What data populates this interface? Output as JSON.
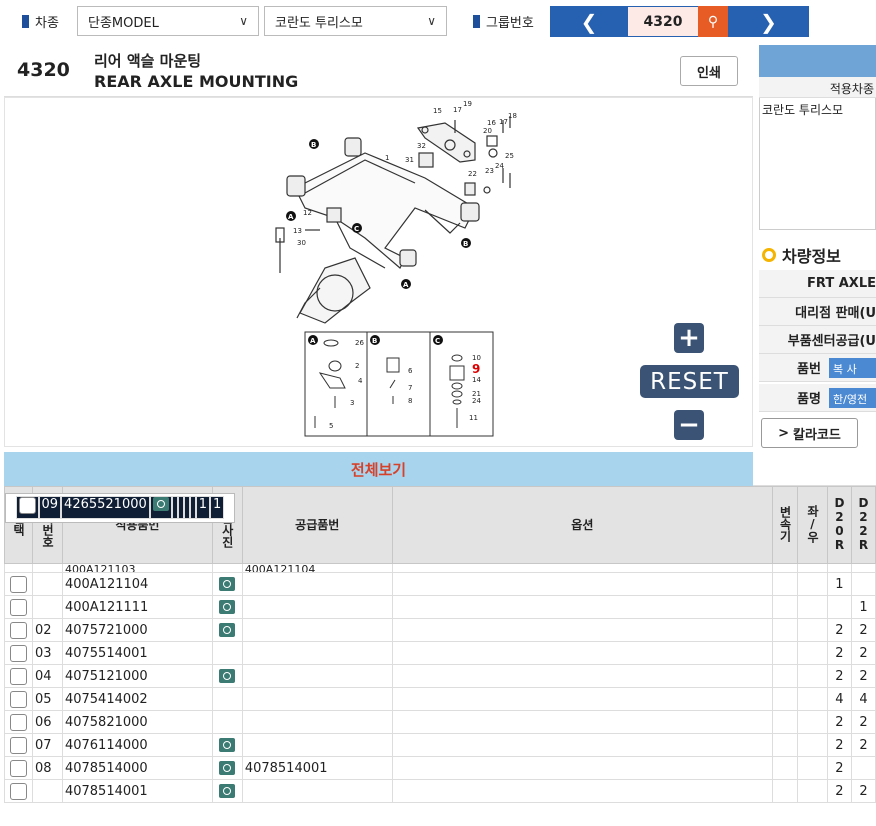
{
  "topbar": {
    "car_label": "차종",
    "model_select": "단종MODEL",
    "vehicle_select": "코란도 투리스모",
    "group_label": "그룹번호",
    "group_number": "4320"
  },
  "header": {
    "group_no": "4320",
    "title_ko": "리어 액슬 마운팅",
    "title_en": "REAR AXLE MOUNTING",
    "print_label": "인쇄"
  },
  "diagram": {
    "reset_label": "RESET",
    "plus": "+",
    "minus": "−",
    "callouts": [
      "1",
      "2",
      "3",
      "4",
      "5",
      "6",
      "7",
      "8",
      "9",
      "10",
      "11",
      "12",
      "13",
      "14",
      "15",
      "16",
      "17",
      "18",
      "19",
      "20",
      "21",
      "22",
      "23",
      "24",
      "25",
      "26",
      "30",
      "31",
      "32"
    ],
    "highlight_callout": "9"
  },
  "right": {
    "applied_col": "적용차종",
    "applied_value": "코란도 투리스모",
    "vehicle_info_title": "차량정보",
    "rows": [
      "FRT AXLE",
      "대리점 판매(U",
      "부품센터공급(U",
      "품번",
      "품명"
    ],
    "btn_copy": "복 사",
    "btn_name": "한/영전",
    "color_code_label": "칼라코드"
  },
  "table": {
    "all_view": "전체보기",
    "headers": [
      "선택",
      "지시번호",
      "적용품번",
      "부품사진",
      "공급품번",
      "옵션",
      "변속기",
      "좌/우",
      "D20R",
      "D22R"
    ],
    "partial_row": {
      "part": "400A121103",
      "supply": "400A121104"
    },
    "rows": [
      {
        "idx": "",
        "part": "400A121104",
        "photo": true,
        "supply": "",
        "d20": "1",
        "d22": ""
      },
      {
        "idx": "",
        "part": "400A121111",
        "photo": true,
        "supply": "",
        "d20": "",
        "d22": "1"
      },
      {
        "idx": "02",
        "part": "4075721000",
        "photo": true,
        "supply": "",
        "d20": "2",
        "d22": "2"
      },
      {
        "idx": "03",
        "part": "4075514001",
        "photo": false,
        "supply": "",
        "d20": "2",
        "d22": "2"
      },
      {
        "idx": "04",
        "part": "4075121000",
        "photo": true,
        "supply": "",
        "d20": "2",
        "d22": "2"
      },
      {
        "idx": "05",
        "part": "4075414002",
        "photo": false,
        "supply": "",
        "d20": "4",
        "d22": "4"
      },
      {
        "idx": "06",
        "part": "4075821000",
        "photo": false,
        "supply": "",
        "d20": "2",
        "d22": "2"
      },
      {
        "idx": "07",
        "part": "4076114000",
        "photo": true,
        "supply": "",
        "d20": "2",
        "d22": "2"
      },
      {
        "idx": "08",
        "part": "4078514000",
        "photo": true,
        "supply": "4078514001",
        "d20": "2",
        "d22": ""
      },
      {
        "idx": "",
        "part": "4078514001",
        "photo": true,
        "supply": "",
        "d20": "2",
        "d22": "2"
      },
      {
        "idx": "09",
        "part": "4265521000",
        "photo": true,
        "supply": "",
        "d20": "1",
        "d22": "1",
        "selected": true
      }
    ]
  }
}
